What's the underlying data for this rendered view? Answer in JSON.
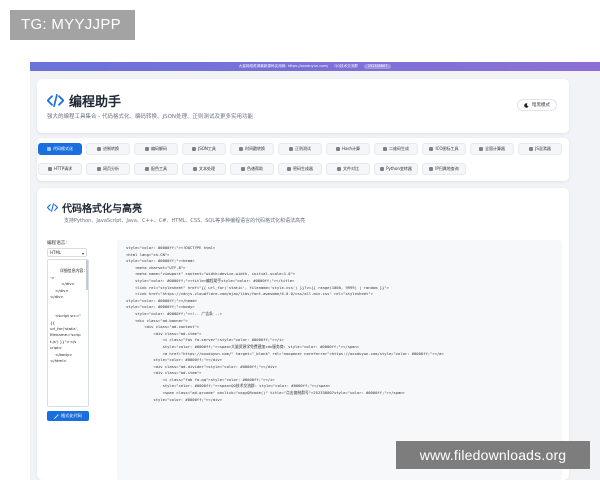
{
  "tg_badge": "TG: MYYJJPP",
  "watermark": "www.filedownloads.org",
  "banner": {
    "text": "大量网络资源最新源码实用网: https://oxxduyun.com/",
    "qq_text": "QQ技术交流群",
    "pill": "252338807"
  },
  "header": {
    "title": "编程助手",
    "subtitle": "强大的编程工具集合 - 代码格式化、编码转换、JSON处理、正则测试及更多实用功能",
    "theme_button": "暗黑模式"
  },
  "tools": [
    {
      "label": "代码格式化",
      "active": true
    },
    {
      "label": "进制转换",
      "active": false
    },
    {
      "label": "编码解码",
      "active": false
    },
    {
      "label": "JSON工具",
      "active": false
    },
    {
      "label": "时间戳转换",
      "active": false
    },
    {
      "label": "正则测试",
      "active": false
    },
    {
      "label": "Hash计算",
      "active": false
    },
    {
      "label": "二维码生成",
      "active": false
    },
    {
      "label": "ICO图标工具",
      "active": false
    },
    {
      "label": "全国计算器",
      "active": false
    },
    {
      "label": "JS混淆器",
      "active": false
    },
    {
      "label": "HTTP请求",
      "active": false
    },
    {
      "label": "网页分析",
      "active": false
    },
    {
      "label": "配色工具",
      "active": false
    },
    {
      "label": "文本处理",
      "active": false
    },
    {
      "label": "色谱帮助",
      "active": false
    },
    {
      "label": "密码生成器",
      "active": false
    },
    {
      "label": "文件对比",
      "active": false
    },
    {
      "label": "Python变转器",
      "active": false
    },
    {
      "label": "IP归属地查询",
      "active": false
    }
  ],
  "main": {
    "title": "代码格式化与高亮",
    "desc": "支持Python、JavaScript、Java、C++、C#、HTML、CSS、SQL等多种编程语言的代码格式化和语法高亮",
    "language_label": "编程语言:",
    "language_value": "HTML",
    "input_text": "详细信息内容：\n·>\n         </div>\n    </div>\n</div>\n\n\n    <script src=\"\n{{\nurl_for('static',\nfilename='scrip\nt.js') }}\"></s\ncript>\n    </body>\n</html>",
    "format_button": "格式化代码"
  },
  "code_lines": [
    "style=\"color: #0000ff;\">&lt;!DOCTYPE html&gt;",
    "&lt;html lang=\"zh-CN\"&gt;",
    "style=\"color: #0000ff;\">&lt;head&gt;",
    "    &lt;meta charset=\"UTF-8\"&gt;",
    "    &lt;meta name=\"viewport\" content=\"width=device-width, initial-scale=1.0\"&gt;",
    "    style=\"color: #0000ff;\">&lt;title&gt;编程助手style=\"color: #0000ff;\">&lt;/title&gt;",
    "    &lt;link rel=\"stylesheet\" href=\"{{ url_for('static', filename='style.css') }}?v={{ range(1000, 9999) | random }}\"&gt;",
    "    &lt;link href=\"https://cdnjs.cloudflare.com/ajax/libs/font-awesome/6.0.0/css/all.min.css\" rel=\"stylesheet\"&gt;",
    "style=\"color: #0000ff;\">&lt;/head&gt;",
    "style=\"color: #0000ff;\">&lt;body&gt;",
    "    style=\"color: #0000ff;\">&lt;!-- 广告条 --&gt;",
    "    &lt;div class=\"ad-banner\"&gt;",
    "        &lt;div class=\"ad-content\"&gt;",
    "            &lt;div class=\"ad-item\"&gt;",
    "                &lt;i class=\"fas fa-server\"&gt;style=\"color: #0000ff;\">&lt;/i&gt;",
    "                style=\"color: #0000ff;\">&lt;span&gt;大量资源学免费建加cdn服务商: style=\"color: #0000ff;\">&lt;/span&gt;",
    "                &lt;a href=\"https://oxxduyun.com/\" target=\"_blank\" rel=\"noopener noreferrer\"&gt;https://oxxduyun.com/style=\"color: #0000ff;\">&lt;/a&gt;",
    "            style=\"color: #0000ff;\">&lt;/div&gt;",
    "            &lt;div class=\"ad-divider\"&gt;style=\"color: #0000ff;\">&lt;/div&gt;",
    "            &lt;div class=\"ad-item\"&gt;",
    "                &lt;i class=\"fab fa-qq\"&gt;style=\"color: #0000ff;\">&lt;/i&gt;",
    "                style=\"color: #0000ff;\">&lt;span&gt;QQ技术交流群: style=\"color: #0000ff;\">&lt;/span&gt;",
    "                &lt;span class=\"ad-qrcode\" onclick=\"copyQRcode()\" title=\"点击复制群号\"&gt;252338807style=\"color: #0000ff;\">&lt;/span&gt;",
    "            style=\"color: #0000ff;\">&lt;/div&gt;"
  ],
  "colors": {
    "primary": "#1a6fe0",
    "banner": "#6a73d8",
    "page_bg": "#f1f3f6",
    "code_attr": "#1a7f37"
  }
}
